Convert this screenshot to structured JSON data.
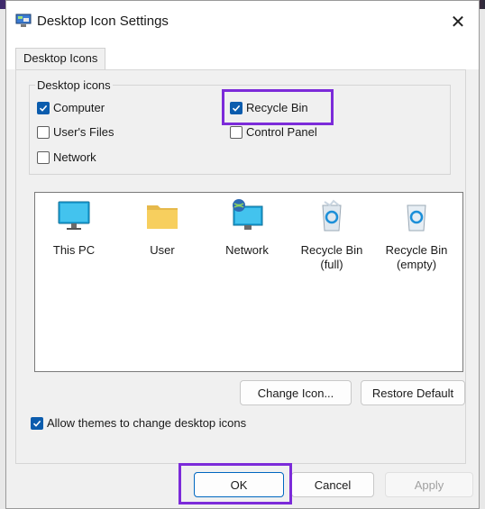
{
  "window": {
    "title": "Desktop Icon Settings",
    "close_glyph": "✕"
  },
  "tabs": [
    {
      "label": "Desktop Icons"
    }
  ],
  "group": {
    "legend": "Desktop icons",
    "checkboxes": [
      {
        "label": "Computer",
        "checked": true
      },
      {
        "label": "Recycle Bin",
        "checked": true
      },
      {
        "label": "User's Files",
        "checked": false
      },
      {
        "label": "Control Panel",
        "checked": false
      },
      {
        "label": "Network",
        "checked": false
      }
    ]
  },
  "icons": [
    {
      "label": "This PC",
      "icon": "monitor-icon"
    },
    {
      "label": "User",
      "icon": "folder-icon"
    },
    {
      "label": "Network",
      "icon": "network-icon"
    },
    {
      "label": "Recycle Bin\n(full)",
      "icon": "recycle-bin-full-icon"
    },
    {
      "label": "Recycle Bin\n(empty)",
      "icon": "recycle-bin-empty-icon"
    }
  ],
  "buttons": {
    "change_icon": "Change Icon...",
    "restore_default": "Restore Default",
    "ok": "OK",
    "cancel": "Cancel",
    "apply": "Apply"
  },
  "allow_themes": {
    "label": "Allow themes to change desktop icons",
    "checked": true
  },
  "colors": {
    "accent": "#0b5cad",
    "highlight": "#7c2bd9"
  }
}
